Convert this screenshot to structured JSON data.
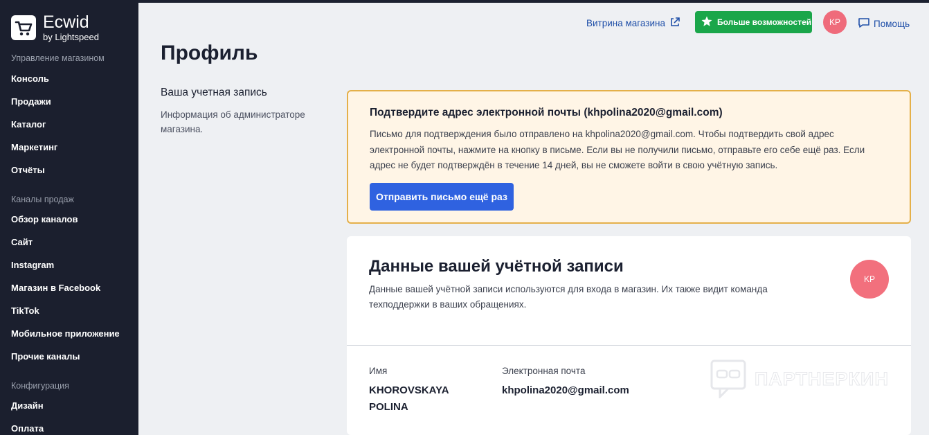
{
  "sidebar": {
    "logo_title": "Ecwid",
    "logo_subtitle": "by Lightspeed",
    "section_manage": "Управление магазином",
    "manage_items": [
      "Консоль",
      "Продажи",
      "Каталог",
      "Маркетинг",
      "Отчёты"
    ],
    "section_channels": "Каналы продаж",
    "channel_items": [
      "Обзор каналов",
      "Сайт",
      "Instagram",
      "Магазин в Facebook",
      "TikTok",
      "Мобильное приложение",
      "Прочие каналы"
    ],
    "section_config": "Конфигурация",
    "config_items": [
      "Дизайн",
      "Оплата"
    ]
  },
  "header": {
    "storefront_link": "Витрина магазина",
    "upgrade_button": "Больше возможностей",
    "avatar_initials": "KP",
    "help_link": "Помощь"
  },
  "page": {
    "title": "Профиль",
    "account_section_title": "Ваша учетная запись",
    "account_section_desc": "Информация об администраторе магазина."
  },
  "warning": {
    "title": "Подтвердите адрес электронной почты (khpolina2020@gmail.com)",
    "text": "Письмо для подтверждения было отправлено на khpolina2020@gmail.com. Чтобы подтвердить свой адрес электронной почты, нажмите на кнопку в письме. Если вы не получили письмо, отправьте его себе ещё раз. Если адрес не будет подтверждён в течение 14 дней, вы не сможете войти в свою учётную запись.",
    "button": "Отправить письмо ещё раз"
  },
  "account_card": {
    "title": "Данные вашей учётной записи",
    "desc": "Данные вашей учётной записи используются для входа в магазин. Их также видит команда техподдержки в ваших обращениях.",
    "avatar_initials": "KP",
    "name_label": "Имя",
    "name_value": "KHOROVSKAYA POLINA",
    "email_label": "Электронная почта",
    "email_value": "khpolina2020@gmail.com"
  },
  "watermark": "ПАРТНЕРКИН",
  "colors": {
    "sidebar_bg": "#1b1f2e",
    "accent_blue": "#2f62e0",
    "upgrade_green": "#1aa64a",
    "avatar_pink": "#ef6b7b",
    "warning_border": "#e4b04a",
    "warning_bg": "#fff5e6"
  },
  "icons": {
    "logo": "cart-icon",
    "storefront": "external-link-icon",
    "upgrade": "star-icon",
    "help": "chat-bubble-icon"
  }
}
